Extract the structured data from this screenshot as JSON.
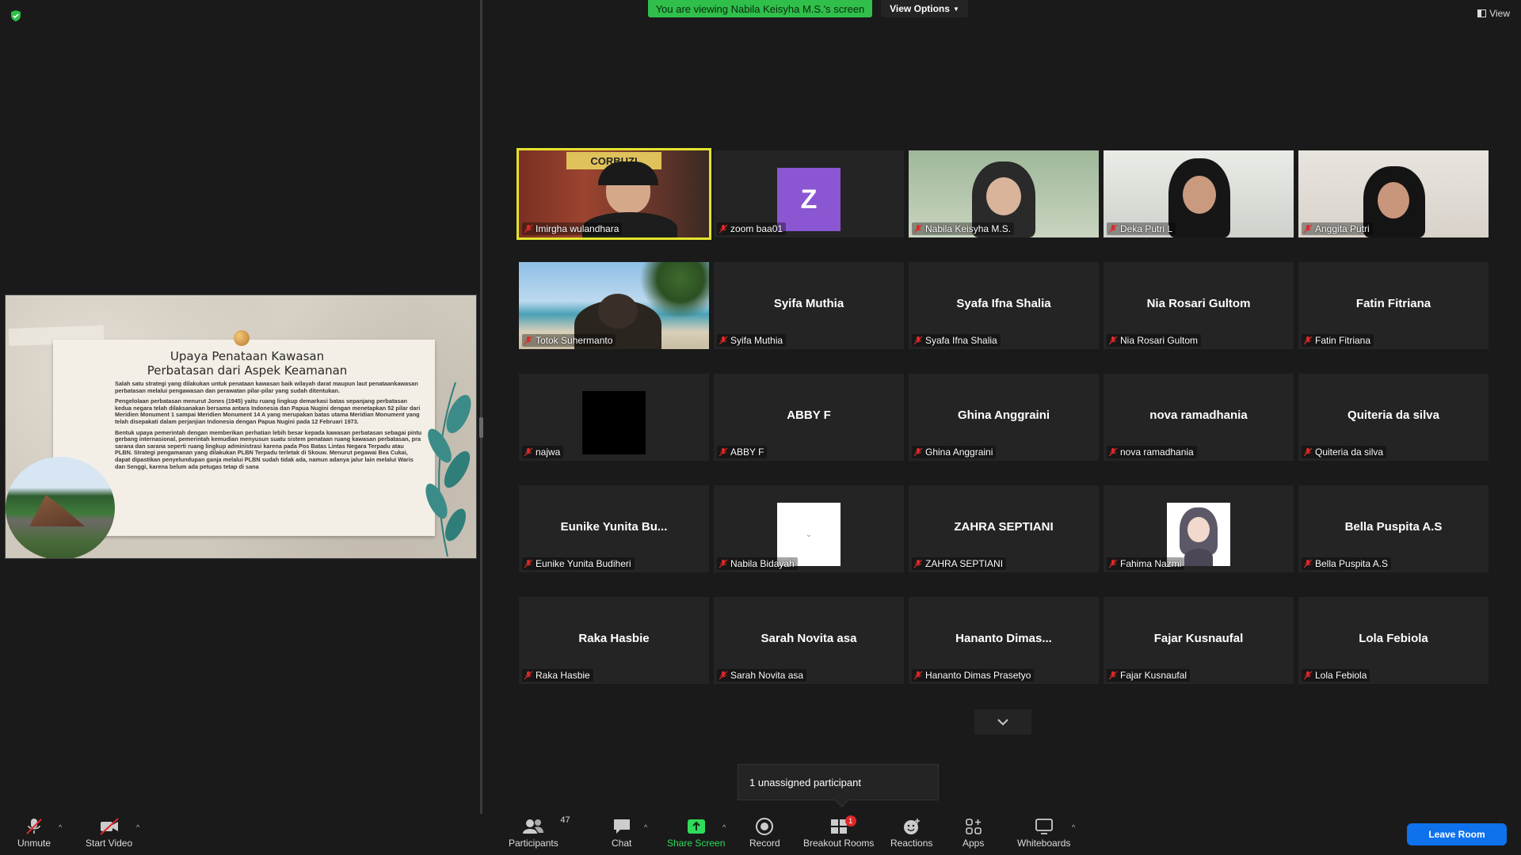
{
  "top": {
    "viewing_banner": "You are viewing Nabila Keisyha M.S.'s screen",
    "view_options": "View Options",
    "view_label": "View"
  },
  "slide": {
    "title_line1": "Upaya Penataan Kawasan",
    "title_line2": "Perbatasan dari Aspek Keamanan",
    "para1": "Salah satu strategi yang dilakukan untuk penataan kawasan baik wilayah darat maupun laut penataankawasan perbatasan melalui pengawasan dan perawatan pilar-pilar yang sudah ditentukan.",
    "para2": "Pengelolaan perbatasan menurut Jones (1945) yaitu ruang lingkup demarkasi batas sepanjang perbatasan kedua negara telah dilaksanakan bersama antara Indonesia dan Papua Nugini dengan menetapkan 52 pilar dari Meridien Monument 1 sampai Meridien Monument 14 A yang merupakan batas utama Meridian Monument yang telah disepakati dalam perjanjian Indonesia dengan Papua Nugini pada 12 Februari 1973.",
    "para3": "Bentuk upaya pemerintah dengan memberikan perhatian lebih besar kepada kawasan perbatasan sebagai pintu gerbang internasional, pemerintah kemudian menyusun suatu sistem penataan ruang kawasan perbatasan, pra sarana dan sarana seperti ruang lingkup administrasi karena pada Pos Batas Lintas Negara Terpadu atau PLBN. Strategi pengamanan yang dilakukan PLBN Terpadu terletak di Skouw. Menurut pegawai Bea Cukai, dapat dipastikan penyelundupan ganja melalui PLBN sudah tidak ada, namun adanya jalur lain melalui Waris dan Senggi, karena belum ada petugas tetap di sana"
  },
  "participants": [
    {
      "label": "Imirgha wulandhara",
      "type": "video"
    },
    {
      "label": "zoom baa01",
      "type": "avatar-letter",
      "letter": "Z"
    },
    {
      "label": "Nabila Keisyha M.S.",
      "type": "video"
    },
    {
      "label": "Deka Putri L",
      "type": "video"
    },
    {
      "label": "Anggita Putri",
      "type": "video"
    },
    {
      "label": "Totok Suhermanto",
      "type": "video"
    },
    {
      "label": "Syifa Muthia",
      "big": "Syifa Muthia",
      "type": "name"
    },
    {
      "label": "Syafa Ifna Shalia",
      "big": "Syafa Ifna Shalia",
      "type": "name"
    },
    {
      "label": "Nia Rosari Gultom",
      "big": "Nia Rosari Gultom",
      "type": "name"
    },
    {
      "label": "Fatin Fitriana",
      "big": "Fatin Fitriana",
      "type": "name"
    },
    {
      "label": "najwa",
      "type": "avatar-black"
    },
    {
      "label": "ABBY F",
      "big": "ABBY F",
      "type": "name"
    },
    {
      "label": "Ghina Anggraini",
      "big": "Ghina Anggraini",
      "type": "name"
    },
    {
      "label": "nova ramadhania",
      "big": "nova ramadhania",
      "type": "name"
    },
    {
      "label": "Quiteria da silva",
      "big": "Quiteria da silva",
      "type": "name"
    },
    {
      "label": "Eunike Yunita Budiheri",
      "big": "Eunike  Yunita  Bu...",
      "type": "name"
    },
    {
      "label": "Nabila Bidayah",
      "type": "avatar-white"
    },
    {
      "label": "ZAHRA SEPTIANI",
      "big": "ZAHRA SEPTIANI",
      "type": "name"
    },
    {
      "label": "Fahima Nazmi",
      "type": "avatar-photo"
    },
    {
      "label": "Bella Puspita A.S",
      "big": "Bella Puspita A.S",
      "type": "name"
    },
    {
      "label": "Raka Hasbie",
      "big": "Raka Hasbie",
      "type": "name"
    },
    {
      "label": "Sarah Novita asa",
      "big": "Sarah Novita asa",
      "type": "name"
    },
    {
      "label": "Hananto Dimas Prasetyo",
      "big": "Hananto  Dimas...",
      "type": "name"
    },
    {
      "label": "Fajar Kusnaufal",
      "big": "Fajar Kusnaufal",
      "type": "name"
    },
    {
      "label": "Lola Febiola",
      "big": "Lola Febiola",
      "type": "name"
    }
  ],
  "unassigned": "1 unassigned participant",
  "toolbar": {
    "unmute": "Unmute",
    "start_video": "Start Video",
    "participants": "Participants",
    "participants_count": "47",
    "chat": "Chat",
    "share_screen": "Share Screen",
    "record": "Record",
    "breakout_rooms": "Breakout Rooms",
    "breakout_badge": "1",
    "reactions": "Reactions",
    "apps": "Apps",
    "whiteboards": "Whiteboards",
    "leave_room": "Leave Room"
  },
  "colors": {
    "banner_green": "#2fbf4a",
    "active_speaker": "#e4e32e",
    "leave_blue": "#0e72ed",
    "mute_red": "#e02828"
  }
}
